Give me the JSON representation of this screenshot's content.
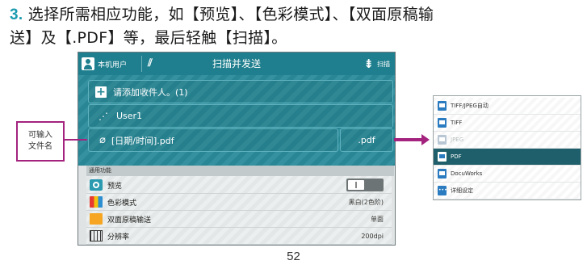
{
  "instruction": {
    "step_number": "3.",
    "line1": "选择所需相应功能，如【预览】、【色彩模式】、【双面原稿输",
    "line2": "送】及【.PDF】等，最后轻触【扫描】。"
  },
  "screen": {
    "user_label": "本机用户",
    "title": "扫描并发送",
    "send_label": "扫描",
    "add_recipient": "请添加收件人。(1)",
    "recipient": "User1",
    "filename": "[日期/时间].pdf",
    "extension": ".pdf",
    "functions_header": "通用功能",
    "functions": [
      {
        "label": "预览",
        "value": ""
      },
      {
        "label": "色彩模式",
        "value": "黑白(2色阶)"
      },
      {
        "label": "双面原稿输送",
        "value": "单面"
      },
      {
        "label": "分辨率",
        "value": "200dpi"
      }
    ]
  },
  "callout": {
    "line1": "可输入",
    "line2": "文件名"
  },
  "file_menu": {
    "items": [
      {
        "label": "TIFF/JPEG自动",
        "state": "normal"
      },
      {
        "label": "TIFF",
        "state": "normal"
      },
      {
        "label": "JPEG",
        "state": "disabled"
      },
      {
        "label": "PDF",
        "state": "selected"
      },
      {
        "label": "DocuWorks",
        "state": "normal"
      },
      {
        "label": "详细设定",
        "state": "normal"
      }
    ]
  },
  "page_number": "52",
  "colors": {
    "accent_teal": "#1f7f8e",
    "callout_magenta": "#a3237f",
    "selected_row": "#1f5f6b"
  }
}
